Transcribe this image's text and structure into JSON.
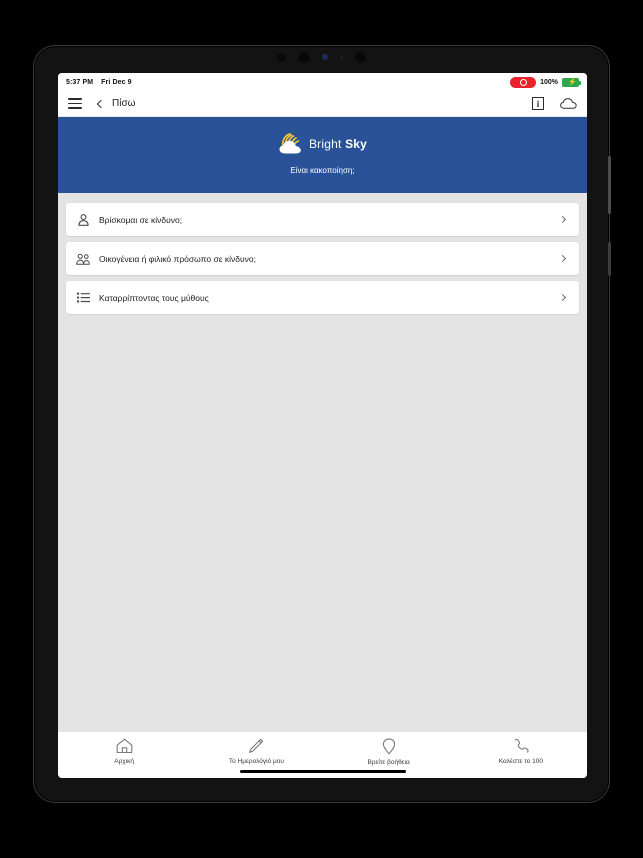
{
  "status_bar": {
    "time": "5:37 PM",
    "date": "Fri Dec 9",
    "recording_icon": "record-indicator-icon",
    "battery_percent": "100%",
    "battery_icon": "battery-charging-icon",
    "battery_color": "#2ea84a",
    "recording_color": "#e8232a"
  },
  "header": {
    "menu_icon": "hamburger-menu-icon",
    "back_label": "Πίσω",
    "back_icon": "chevron-left-icon",
    "info_icon": "info-icon",
    "cloud_icon": "cloud-icon"
  },
  "banner": {
    "logo_icon": "bright-sky-cloud-sun-logo",
    "title_regular": "Bright ",
    "title_bold": "Sky",
    "subtitle": "Είναι κακοποίηση;",
    "background_color": "#2a5298",
    "logo_cloud_color": "#ffffff",
    "logo_rays_color": "#f4c430"
  },
  "menu_items": [
    {
      "label": "Βρίσκομαι σε κίνδυνο;",
      "icon": "person-icon",
      "chevron": "chevron-right-icon"
    },
    {
      "label": "Οικογένεια ή φιλικό πρόσωπο σε κίνδυνο;",
      "icon": "people-group-icon",
      "chevron": "chevron-right-icon"
    },
    {
      "label": "Καταρρίπτοντας τους μύθους",
      "icon": "list-icon",
      "chevron": "chevron-right-icon"
    }
  ],
  "bottom_nav": [
    {
      "label": "Αρχική",
      "icon": "home-icon"
    },
    {
      "label": "Το Ημερολόγιό μου",
      "icon": "pencil-icon"
    },
    {
      "label": "Βρείτε βοήθεια",
      "icon": "location-pin-icon"
    },
    {
      "label": "Καλέστε το 100",
      "icon": "phone-icon"
    }
  ],
  "theme": {
    "content_background": "#e4e4e4",
    "card_background": "#ffffff",
    "text_primary": "#212121"
  }
}
